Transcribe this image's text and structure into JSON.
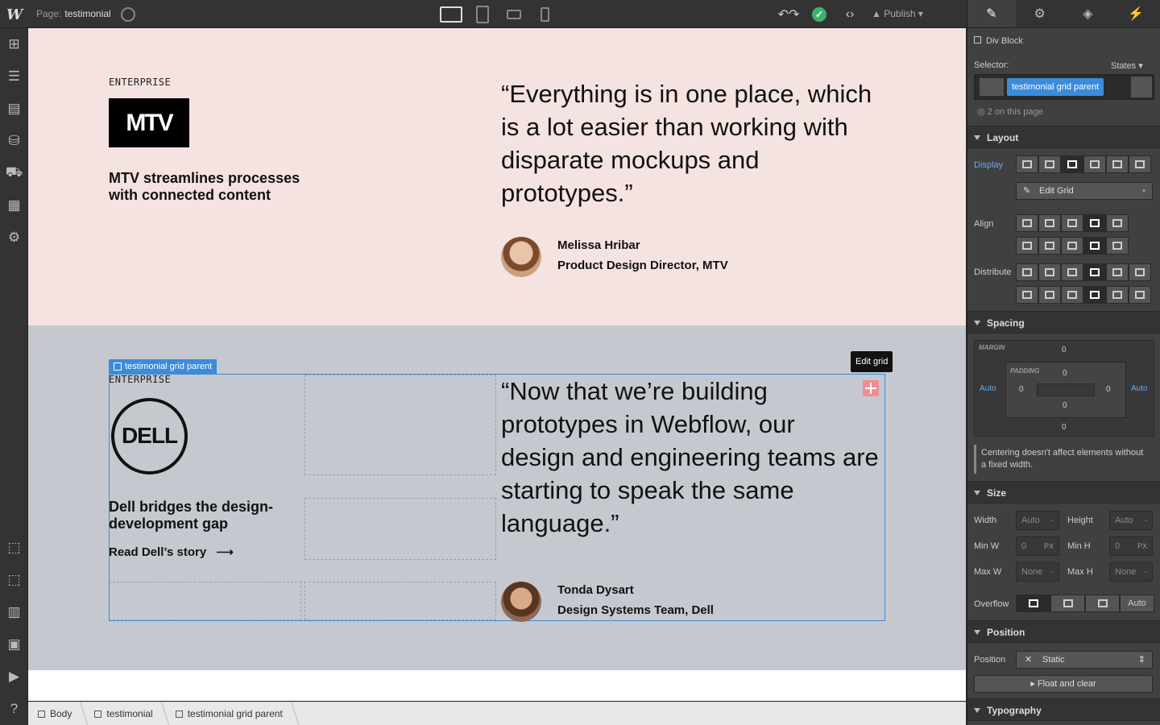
{
  "topbar": {
    "logo": "W",
    "page_label": "Page:",
    "page_name": "testimonial",
    "publish_label": "Publish"
  },
  "canvas": {
    "section1": {
      "eyebrow": "ENTERPRISE",
      "logo_text": "MTV",
      "story_title_1": "MTV streamlines processes",
      "story_title_2": "with connected content",
      "quote_1": "“Everything is in one place, which",
      "quote_2": "is a lot easier than working with",
      "quote_3": "disparate mockups and",
      "quote_4": "prototypes.”",
      "person_name": "Melissa Hribar",
      "person_role": "Product Design Director, MTV"
    },
    "section2": {
      "eyebrow": "ENTERPRISE",
      "logo_text": "D<span>E</span>LL",
      "story_title_1": "Dell bridges the design-",
      "story_title_2": "development gap",
      "read_link": "Read Dell’s story",
      "quote_1": "“Now that we’re building",
      "quote_2": "prototypes in Webflow, our",
      "quote_3": "design and engineering teams are",
      "quote_4": "starting to speak the same",
      "quote_5": "language.”",
      "person_name": "Tonda Dysart",
      "person_role": "Design Systems Team, Dell",
      "selection_tag": "testimonial grid parent",
      "tooltip": "Edit grid"
    }
  },
  "breadcrumb": {
    "items": [
      "Body",
      "testimonial",
      "testimonial grid parent"
    ]
  },
  "panel": {
    "element_type": "Div Block",
    "selector_label": "Selector:",
    "states_label": "States",
    "selector_chip": "testimonial grid parent",
    "usage_count": "2 on this page",
    "layout": {
      "title": "Layout",
      "display_label": "Display",
      "edit_grid_label": "Edit Grid",
      "align_label": "Align",
      "distribute_label": "Distribute"
    },
    "spacing": {
      "title": "Spacing",
      "margin_label": "MARGIN",
      "padding_label": "PADDING",
      "margin_top": "0",
      "margin_bottom": "0",
      "margin_left": "Auto",
      "margin_right": "Auto",
      "padding_top": "0",
      "padding_bottom": "0",
      "padding_left": "0",
      "padding_right": "0",
      "note": "Centering doesn't affect elements without a fixed width."
    },
    "size": {
      "title": "Size",
      "width_label": "Width",
      "height_label": "Height",
      "width_value": "Auto",
      "height_value": "Auto",
      "minw_label": "Min W",
      "minh_label": "Min H",
      "minw_value": "0",
      "minh_value": "0",
      "unit": "PX",
      "maxw_label": "Max W",
      "maxh_label": "Max H",
      "maxw_value": "None",
      "maxh_value": "None",
      "overflow_label": "Overflow",
      "overflow_auto": "Auto"
    },
    "position": {
      "title": "Position",
      "position_label": "Position",
      "position_value": "Static",
      "float_label": "Float and clear"
    },
    "typography": {
      "title": "Typography"
    }
  }
}
